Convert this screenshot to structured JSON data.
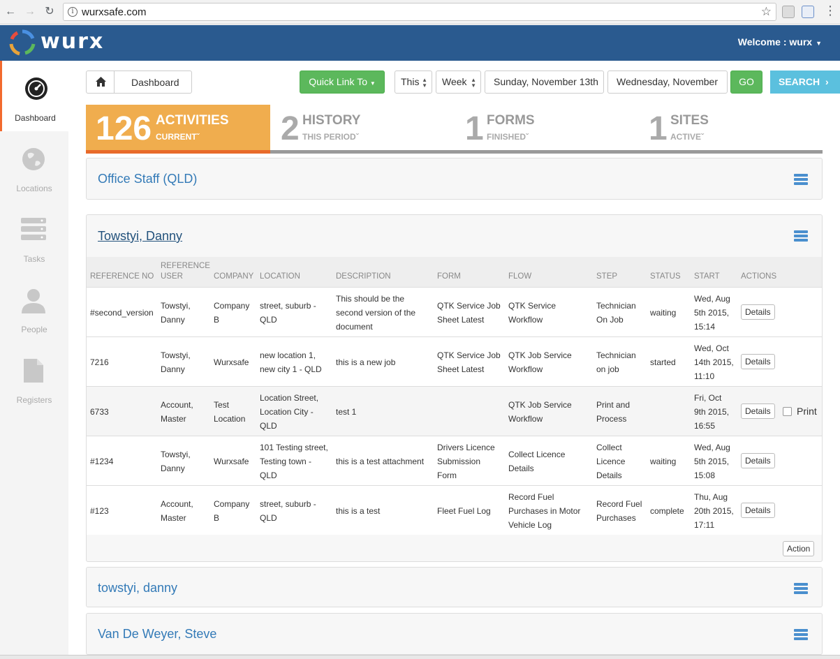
{
  "browser": {
    "url": "wurxsafe.com"
  },
  "header": {
    "brand": "wurx",
    "welcome": "Welcome : wurx"
  },
  "sidebar": {
    "items": [
      {
        "label": "Dashboard",
        "icon": "dashboard-icon"
      },
      {
        "label": "Locations",
        "icon": "globe-icon"
      },
      {
        "label": "Tasks",
        "icon": "tasks-icon"
      },
      {
        "label": "People",
        "icon": "person-icon"
      },
      {
        "label": "Registers",
        "icon": "document-icon"
      }
    ]
  },
  "toolbar": {
    "breadcrumb": "Dashboard",
    "quick_link": "Quick Link To",
    "period_prefix": "This",
    "period_unit": "Week",
    "date_from": "Sunday, November 13th",
    "date_to": "Wednesday, November",
    "go_label": "GO",
    "search_label": "SEARCH"
  },
  "stats": [
    {
      "number": "126",
      "title": "ACTIVITIES",
      "sub": "CURRENT"
    },
    {
      "number": "2",
      "title": "HISTORY",
      "sub": "THIS PERIOD"
    },
    {
      "number": "1",
      "title": "FORMS",
      "sub": "FINISHED"
    },
    {
      "number": "1",
      "title": "SITES",
      "sub": "ACTIVE"
    }
  ],
  "groups": [
    {
      "title": "Office Staff (QLD)"
    },
    {
      "title": "Towstyi, Danny"
    },
    {
      "title": "towstyi, danny"
    },
    {
      "title": "Van De Weyer, Steve"
    }
  ],
  "table": {
    "headers": {
      "ref": "REFERENCE NO",
      "user_1": "REFERENCE",
      "user_2": "USER",
      "company": "COMPANY",
      "location": "LOCATION",
      "description": "DESCRIPTION",
      "form": "FORM",
      "flow": "FLOW",
      "step": "STEP",
      "status": "STATUS",
      "start": "START",
      "actions": "ACTIONS"
    },
    "details_label": "Details",
    "print_label": "Print",
    "action_label": "Action",
    "rows": [
      {
        "ref": [
          "#second_version"
        ],
        "user": [
          "Towstyi,",
          "Danny"
        ],
        "company": [
          "Company",
          "B"
        ],
        "location": [
          "street, suburb -",
          "QLD"
        ],
        "description": [
          "This should be the",
          "second version of the",
          "document"
        ],
        "form": [
          "QTK Service Job",
          "Sheet Latest"
        ],
        "flow": [
          "QTK Service",
          "Workflow"
        ],
        "step": [
          "Technician",
          "On Job"
        ],
        "status": [
          "waiting"
        ],
        "start": [
          "Wed, Aug",
          "5th 2015,",
          "15:14"
        ]
      },
      {
        "ref": [
          "7216"
        ],
        "user": [
          "Towstyi,",
          "Danny"
        ],
        "company": [
          "Wurxsafe"
        ],
        "location": [
          "new location 1,",
          "new city 1 - QLD"
        ],
        "description": [
          "this is a new job"
        ],
        "form": [
          "QTK Service Job",
          "Sheet Latest"
        ],
        "flow": [
          "QTK Job Service",
          "Workflow"
        ],
        "step": [
          "Technician",
          "on job"
        ],
        "status": [
          "started"
        ],
        "start": [
          "Wed, Oct",
          "14th 2015,",
          "11:10"
        ]
      },
      {
        "ref": [
          "6733"
        ],
        "user": [
          "Account,",
          "Master"
        ],
        "company": [
          "Test",
          "Location"
        ],
        "location": [
          "Location Street,",
          "Location City -",
          "QLD"
        ],
        "description": [
          "test 1"
        ],
        "form": [],
        "flow": [
          "QTK Job Service",
          "Workflow"
        ],
        "step": [
          "Print and",
          "Process"
        ],
        "status": [],
        "start": [
          "Fri, Oct",
          "9th 2015,",
          "16:55"
        ]
      },
      {
        "ref": [
          "#1234"
        ],
        "user": [
          "Towstyi,",
          "Danny"
        ],
        "company": [
          "Wurxsafe"
        ],
        "location": [
          "101 Testing street,",
          "Testing town -",
          "QLD"
        ],
        "description": [
          "this is a test attachment"
        ],
        "form": [
          "Drivers Licence",
          "Submission",
          "Form"
        ],
        "flow": [
          "Collect Licence",
          "Details"
        ],
        "step": [
          "Collect",
          "Licence",
          "Details"
        ],
        "status": [
          "waiting"
        ],
        "start": [
          "Wed, Aug",
          "5th 2015,",
          "15:08"
        ]
      },
      {
        "ref": [
          "#123"
        ],
        "user": [
          "Account,",
          "Master"
        ],
        "company": [
          "Company",
          "B"
        ],
        "location": [
          "street, suburb -",
          "QLD"
        ],
        "description": [
          "this is a test"
        ],
        "form": [
          "Fleet Fuel Log"
        ],
        "flow": [
          "Record Fuel",
          "Purchases in Motor",
          "Vehicle Log"
        ],
        "step": [
          "Record Fuel",
          "Purchases"
        ],
        "status": [
          "complete"
        ],
        "start": [
          "Thu, Aug",
          "20th 2015,",
          "17:11"
        ]
      }
    ]
  },
  "colors": {
    "header_bg": "#2a5a8f",
    "active_tab": "#f0ad4e",
    "active_tab_border": "#e86a2a",
    "green": "#5cb85c",
    "info": "#5bc0de",
    "link": "#337ab7"
  }
}
